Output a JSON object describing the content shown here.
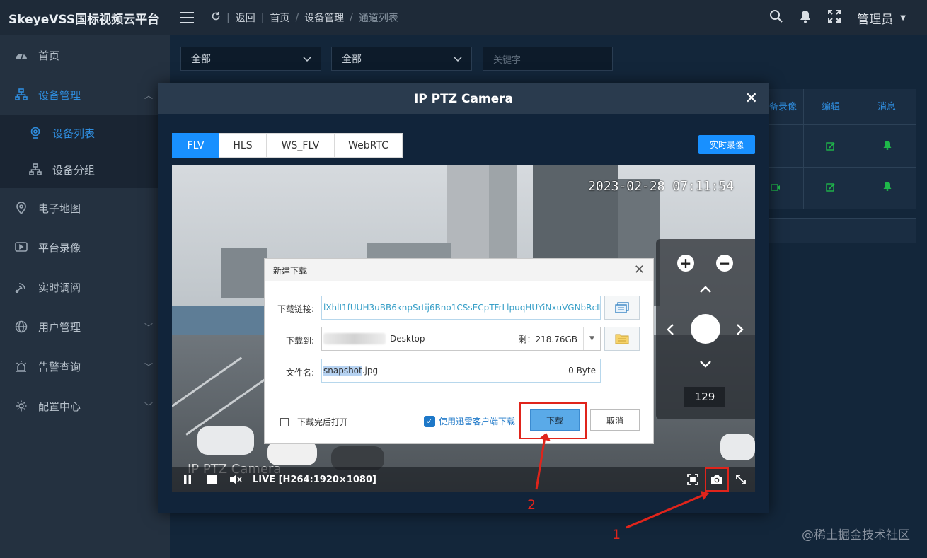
{
  "app": {
    "title": "SkeyeVSS国标视频云平台"
  },
  "header": {
    "breadcrumb": {
      "back": "返回",
      "home": "首页",
      "section": "设备管理",
      "current": "通道列表",
      "sep": "/"
    },
    "user": "管理员"
  },
  "sidebar": {
    "items": [
      {
        "label": "首页",
        "icon": "dashboard-icon"
      },
      {
        "label": "设备管理",
        "icon": "device-tree-icon",
        "active": true
      },
      {
        "label": "电子地图",
        "icon": "map-pin-icon"
      },
      {
        "label": "平台录像",
        "icon": "play-icon"
      },
      {
        "label": "实时调阅",
        "icon": "signal-icon"
      },
      {
        "label": "用户管理",
        "icon": "globe-icon"
      },
      {
        "label": "告警查询",
        "icon": "alarm-icon"
      },
      {
        "label": "配置中心",
        "icon": "gear-icon"
      }
    ],
    "submenu": [
      {
        "label": "设备列表",
        "active": true
      },
      {
        "label": "设备分组"
      }
    ]
  },
  "filters": {
    "select1": "全部",
    "select2": "全部",
    "keyword_placeholder": "关键字"
  },
  "table": {
    "headers": [
      "备录像",
      "编辑",
      "消息"
    ]
  },
  "modal": {
    "title": "IP PTZ Camera",
    "close": "✕",
    "tabs": [
      "FLV",
      "HLS",
      "WS_FLV",
      "WebRTC"
    ],
    "active_tab": "FLV",
    "record_button": "实时录像"
  },
  "video": {
    "timestamp": "2023-02-28 07:11:54",
    "camera_label": "IP PTZ Camera",
    "live_label": "LIVE [H264:1920×1080]",
    "ptz_speed": "129"
  },
  "download_dialog": {
    "title": "新建下载",
    "link_label": "下载链接:",
    "link_value": "lXhlI1fUUH3uBB6knpSrtij6Bno1CSsECpTFrLlpuqHUYiNxuVGNbRcIL...",
    "save_label": "下载到:",
    "save_path": "Desktop",
    "free_space": "剩：218.76GB",
    "filename_label": "文件名:",
    "filename_selected": "snapshot",
    "filename_ext": ".jpg",
    "file_size": "0 Byte",
    "open_after": "下载完后打开",
    "xunlei_link": "使用迅雷客户端下载",
    "download_button": "下载",
    "cancel_button": "取消"
  },
  "annotations": {
    "step1": "1",
    "step2": "2",
    "color": "#e0241b"
  },
  "watermark": "@稀土掘金技术社区",
  "colors": {
    "accent": "#1890ff",
    "sidebar_active": "#2f8dde",
    "green": "#1fb84a"
  }
}
